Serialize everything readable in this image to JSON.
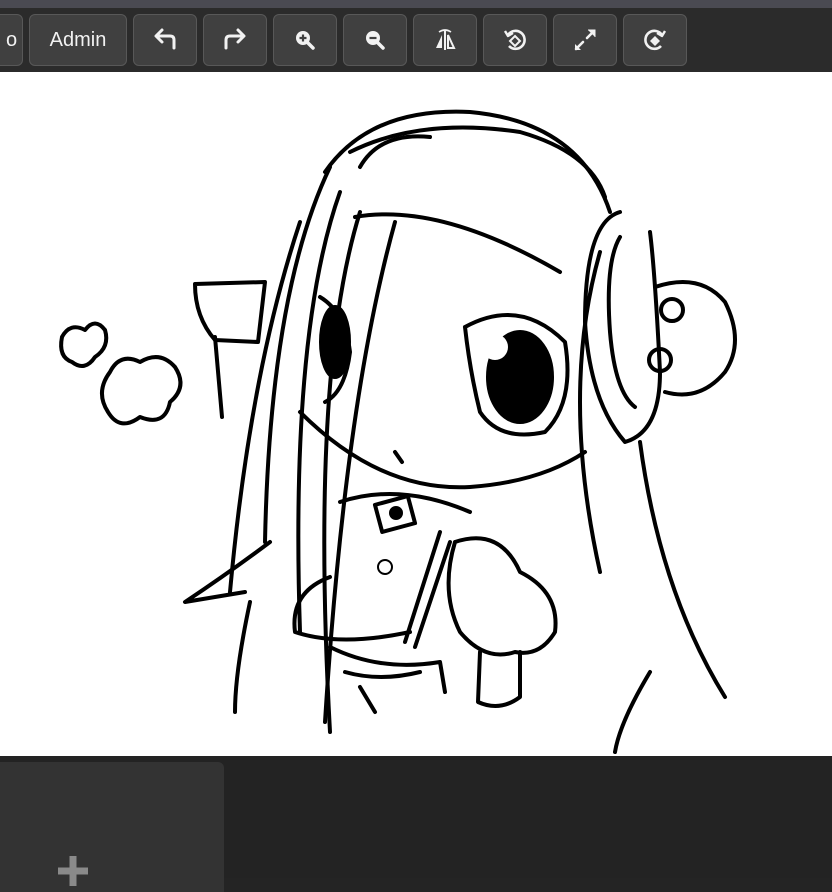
{
  "toolbar": {
    "partial_label": "o",
    "admin_label": "Admin",
    "buttons": [
      {
        "name": "undo",
        "icon": "undo-arrow-icon"
      },
      {
        "name": "redo",
        "icon": "redo-arrow-icon"
      },
      {
        "name": "zoom-in",
        "icon": "zoom-in-icon"
      },
      {
        "name": "zoom-out",
        "icon": "zoom-out-icon"
      },
      {
        "name": "flip",
        "icon": "flip-horizontal-icon"
      },
      {
        "name": "rotate-left",
        "icon": "rotate-left-icon"
      },
      {
        "name": "fit-screen",
        "icon": "expand-icon"
      },
      {
        "name": "rotate-right",
        "icon": "rotate-right-icon"
      }
    ]
  },
  "canvas": {
    "content": "line-art-sketch",
    "background": "#ffffff"
  },
  "layers_panel": {
    "add_icon": "plus-icon"
  },
  "colors": {
    "toolbar_bg": "#2b2b2b",
    "button_bg": "#404040",
    "panel_bg": "#232323",
    "card_bg": "#333333"
  }
}
